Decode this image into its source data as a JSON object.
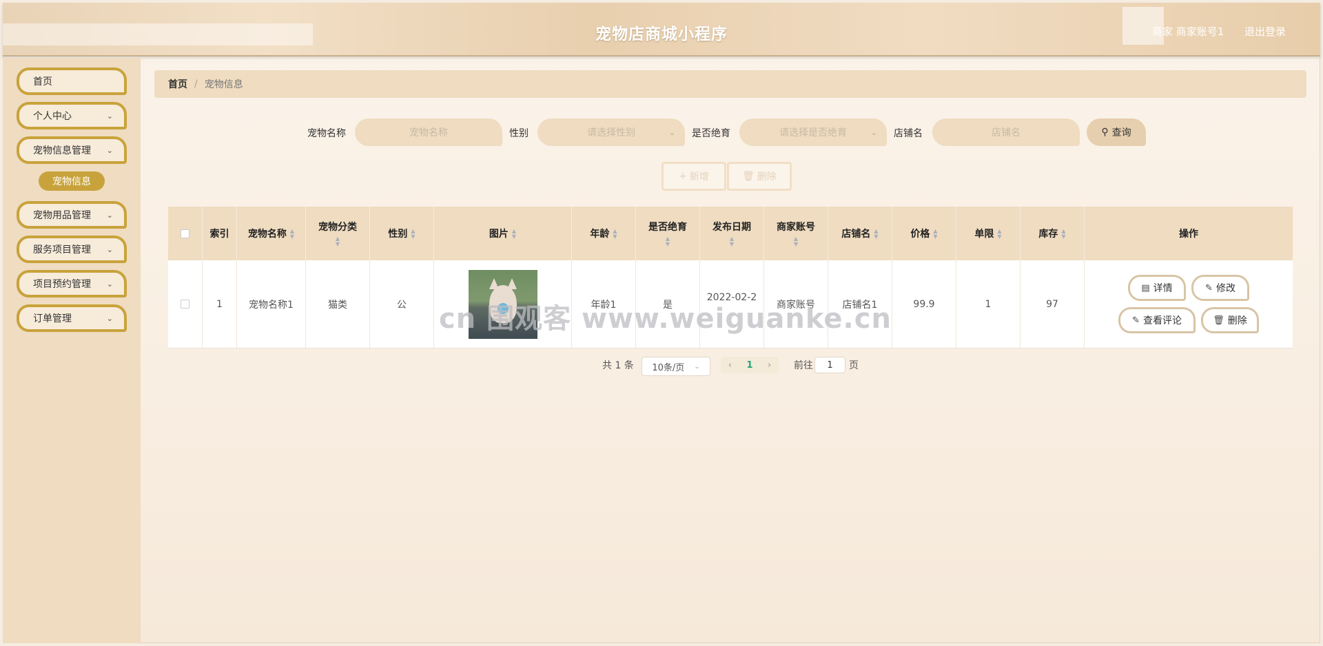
{
  "header": {
    "title": "宠物店商城小程序",
    "user": "商家 商家账号1",
    "logout": "退出登录"
  },
  "sidebar": {
    "items": [
      {
        "label": "首页",
        "chevron": false
      },
      {
        "label": "个人中心",
        "chevron": true
      },
      {
        "label": "宠物信息管理",
        "chevron": true
      },
      {
        "label": "宠物用品管理",
        "chevron": true
      },
      {
        "label": "服务项目管理",
        "chevron": true
      },
      {
        "label": "项目预约管理",
        "chevron": true
      },
      {
        "label": "订单管理",
        "chevron": true
      }
    ],
    "submenu_active": "宠物信息"
  },
  "breadcrumb": {
    "home": "首页",
    "separator": "/",
    "current": "宠物信息"
  },
  "search": {
    "name_label": "宠物名称",
    "name_placeholder": "宠物名称",
    "gender_label": "性别",
    "gender_placeholder": "请选择性别",
    "sterilized_label": "是否绝育",
    "sterilized_placeholder": "请选择是否绝育",
    "shop_label": "店铺名",
    "shop_placeholder": "店铺名",
    "query_label": "查询",
    "query_icon": "search-icon"
  },
  "actions": {
    "add_label": "新增",
    "add_icon": "+",
    "delete_label": "删除",
    "delete_icon": "trash-icon"
  },
  "table": {
    "headers": {
      "index": "索引",
      "name": "宠物名称",
      "category": "宠物分类",
      "gender": "性别",
      "image": "图片",
      "age": "年龄",
      "sterilized": "是否绝育",
      "date": "发布日期",
      "merchant": "商家账号",
      "shop": "店铺名",
      "price": "价格",
      "limit": "单限",
      "stock": "库存",
      "ops": "操作"
    },
    "rows": [
      {
        "index": "1",
        "name": "宠物名称1",
        "category": "猫类",
        "gender": "公",
        "age": "年龄1",
        "sterilized": "是",
        "date": "2022-02-2",
        "merchant": "商家账号",
        "shop": "店铺名1",
        "price": "99.9",
        "limit": "1",
        "stock": "97",
        "ops": {
          "detail": "详情",
          "edit": "修改",
          "comments": "查看评论",
          "delete": "删除"
        }
      }
    ]
  },
  "pagination": {
    "total": "共 1 条",
    "page_size": "10条/页",
    "current": "1",
    "goto_label": "前往",
    "goto_value": "1",
    "page_suffix": "页"
  },
  "watermark": "cn 围观客 www.weiguanke.cn",
  "colors": {
    "accent_gold": "#c8a33b",
    "beige": "#efdcc1",
    "page_active": "#21a37a"
  }
}
